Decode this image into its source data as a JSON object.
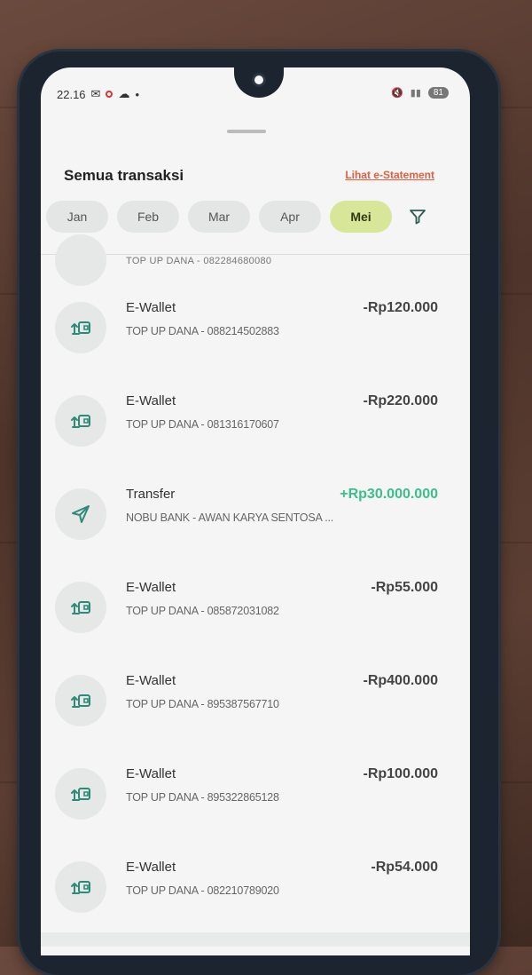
{
  "status": {
    "time": "22.16",
    "battery": "81"
  },
  "header": {
    "title": "Semua transaksi",
    "estatement": "Lihat e-Statement"
  },
  "months": [
    "Jan",
    "Feb",
    "Mar",
    "Apr",
    "Mei"
  ],
  "active_month": "Mei",
  "partial_row": {
    "desc": "TOP UP DANA - 082284680080"
  },
  "transactions": [
    {
      "category": "E-Wallet",
      "desc": "TOP UP DANA - 088214502883",
      "amount": "-Rp120.000",
      "type": "ewallet"
    },
    {
      "category": "E-Wallet",
      "desc": "TOP UP DANA - 081316170607",
      "amount": "-Rp220.000",
      "type": "ewallet"
    },
    {
      "category": "Transfer",
      "desc": "NOBU BANK - AWAN KARYA SENTOSA ...",
      "amount": "+Rp30.000.000",
      "type": "transfer"
    },
    {
      "category": "E-Wallet",
      "desc": "TOP UP DANA - 085872031082",
      "amount": "-Rp55.000",
      "type": "ewallet"
    },
    {
      "category": "E-Wallet",
      "desc": "TOP UP DANA - 895387567710",
      "amount": "-Rp400.000",
      "type": "ewallet"
    },
    {
      "category": "E-Wallet",
      "desc": "TOP UP DANA - 895322865128",
      "amount": "-Rp100.000",
      "type": "ewallet"
    },
    {
      "category": "E-Wallet",
      "desc": "TOP UP DANA - 082210789020",
      "amount": "-Rp54.000",
      "type": "ewallet"
    }
  ],
  "colors": {
    "accent_green": "#3bbf8c",
    "active_chip": "#d8e69a",
    "link": "#e2603f",
    "icon": "#2e8a78"
  }
}
